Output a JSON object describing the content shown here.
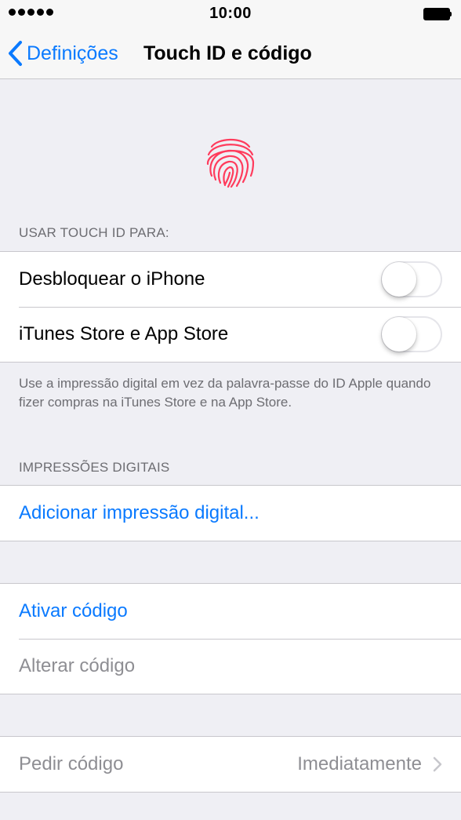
{
  "status_bar": {
    "time": "10:00"
  },
  "nav": {
    "back_label": "Definições",
    "title": "Touch ID e código"
  },
  "touch_id_section": {
    "header": "USAR TOUCH ID PARA:",
    "items": [
      {
        "label": "Desbloquear o iPhone",
        "enabled": false
      },
      {
        "label": "iTunes Store e App Store",
        "enabled": false
      }
    ],
    "footer": "Use a impressão digital em vez da palavra-passe do ID Apple quando fizer compras na iTunes Store e na App Store."
  },
  "fingerprints_section": {
    "header": "IMPRESSÕES DIGITAIS",
    "add_label": "Adicionar impressão digital..."
  },
  "passcode_section": {
    "enable_label": "Ativar código",
    "change_label": "Alterar código"
  },
  "require_section": {
    "label": "Pedir código",
    "value": "Imediatamente"
  },
  "colors": {
    "accent": "#0a7aff",
    "fingerprint": "#ff3b5c",
    "background": "#efeff4",
    "secondary_text": "#6d6d72",
    "disabled_text": "#8e8e93"
  }
}
